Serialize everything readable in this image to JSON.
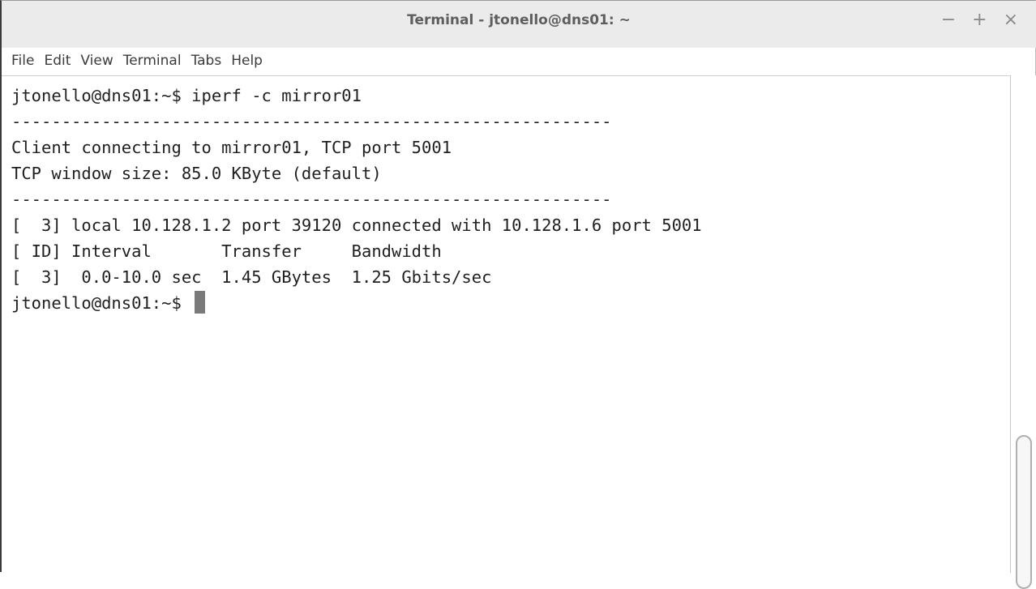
{
  "window": {
    "title": "Terminal - jtonello@dns01: ~",
    "controls": {
      "minimize": "−",
      "maximize": "+",
      "close": "×"
    }
  },
  "menu": {
    "file": "File",
    "edit": "Edit",
    "view": "View",
    "terminal": "Terminal",
    "tabs": "Tabs",
    "help": "Help"
  },
  "terminal": {
    "lines": [
      "jtonello@dns01:~$ iperf -c mirror01",
      "------------------------------------------------------------",
      "Client connecting to mirror01, TCP port 5001",
      "TCP window size: 85.0 KByte (default)",
      "------------------------------------------------------------",
      "[  3] local 10.128.1.2 port 39120 connected with 10.128.1.6 port 5001",
      "[ ID] Interval       Transfer     Bandwidth",
      "[  3]  0.0-10.0 sec  1.45 GBytes  1.25 Gbits/sec"
    ],
    "prompt": "jtonello@dns01:~$ "
  }
}
